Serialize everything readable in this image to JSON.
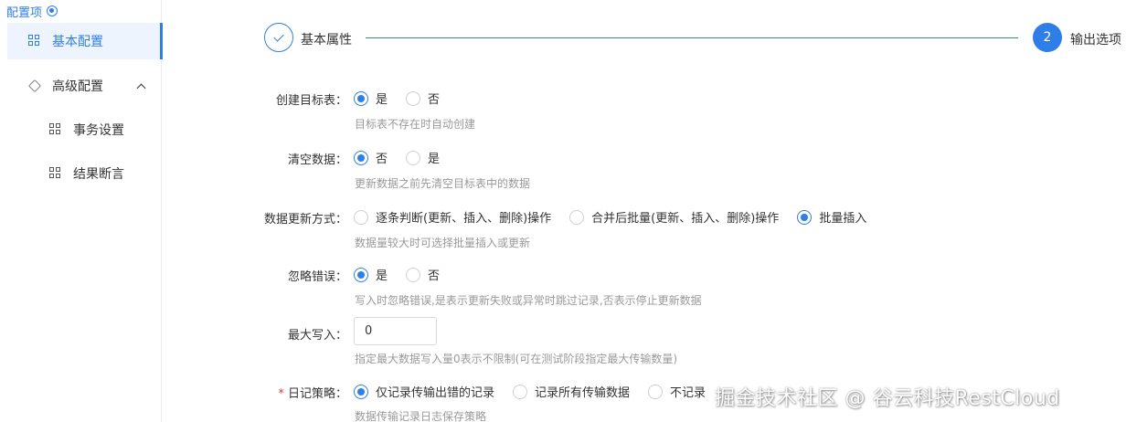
{
  "sidebar": {
    "header": "配置项",
    "items": [
      {
        "label": "基本配置",
        "active": true
      },
      {
        "label": "高级配置"
      },
      {
        "label": "事务设置"
      },
      {
        "label": "结果断言"
      }
    ]
  },
  "steps": [
    {
      "label": "基本属性",
      "state": "done"
    },
    {
      "number": "2",
      "label": "输出选项",
      "state": "current"
    }
  ],
  "form": {
    "create_table": {
      "label": "创建目标表",
      "options": [
        "是",
        "否"
      ],
      "selected": "是",
      "hint": "目标表不存在时自动创建"
    },
    "clear_data": {
      "label": "清空数据",
      "options": [
        "否",
        "是"
      ],
      "selected": "否",
      "hint": "更新数据之前先清空目标表中的数据"
    },
    "update_mode": {
      "label": "数据更新方式",
      "options": [
        "逐条判断(更新、插入、删除)操作",
        "合并后批量(更新、插入、删除)操作",
        "批量插入"
      ],
      "selected": "批量插入",
      "hint": "数据量较大时可选择批量插入或更新"
    },
    "ignore_error": {
      "label": "忽略错误",
      "options": [
        "是",
        "否"
      ],
      "selected": "是",
      "hint": "写入时忽略错误,是表示更新失败或异常时跳过记录,否表示停止更新数据"
    },
    "max_write": {
      "label": "最大写入",
      "value": "0",
      "hint": "指定最大数据写入量0表示不限制(可在测试阶段指定最大传输数量)"
    },
    "log_policy": {
      "required_mark": "*",
      "label": "日记策略",
      "options": [
        "仅记录传输出错的记录",
        "记录所有传输数据",
        "不记录"
      ],
      "selected": "仅记录传输出错的记录",
      "hint": "数据传输记录日志保存策略"
    }
  },
  "label_suffix": "：",
  "watermark": "掘金技术社区 @ 谷云科技RestCloud",
  "colors": {
    "accent": "#2f7ee8",
    "hint": "#999999",
    "required": "#e53935"
  }
}
